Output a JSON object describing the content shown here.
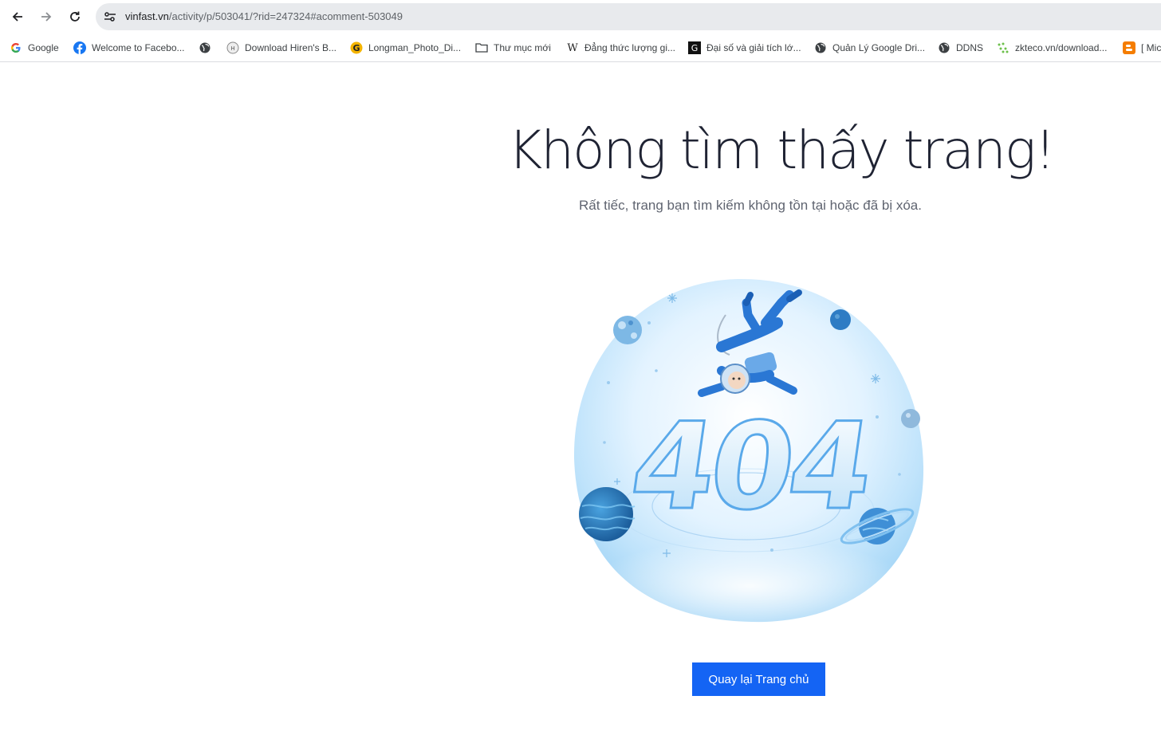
{
  "browser": {
    "url_host": "vinfast.vn",
    "url_path": "/activity/p/503041/?rid=247324#acomment-503049"
  },
  "bookmarks": [
    {
      "label": "Google",
      "icon": "google-icon"
    },
    {
      "label": "Welcome to Facebo...",
      "icon": "facebook-icon"
    },
    {
      "label": "",
      "icon": "globe-icon"
    },
    {
      "label": "Download Hiren's B...",
      "icon": "hirens-icon"
    },
    {
      "label": "Longman_Photo_Di...",
      "icon": "g-icon"
    },
    {
      "label": "Thư mục mới",
      "icon": "folder-icon"
    },
    {
      "label": "Đẳng thức lượng gi...",
      "icon": "wikipedia-icon"
    },
    {
      "label": "Đại số và giải tích lớ...",
      "icon": "g-black-icon"
    },
    {
      "label": "Quản Lý Google Dri...",
      "icon": "globe-icon"
    },
    {
      "label": "DDNS",
      "icon": "globe-icon"
    },
    {
      "label": "zkteco.vn/download...",
      "icon": "zkteco-icon"
    },
    {
      "label": "[ Mic",
      "icon": "blogger-icon"
    }
  ],
  "page": {
    "title": "Không tìm thấy trang!",
    "subtitle": "Rất tiếc, trang bạn tìm kiếm không tồn tại hoặc đã bị xóa.",
    "illustration_text": "404",
    "home_button": "Quay lại Trang chủ"
  },
  "colors": {
    "button": "#1464f4",
    "title": "#1f2333",
    "subtitle": "#5f6470"
  }
}
